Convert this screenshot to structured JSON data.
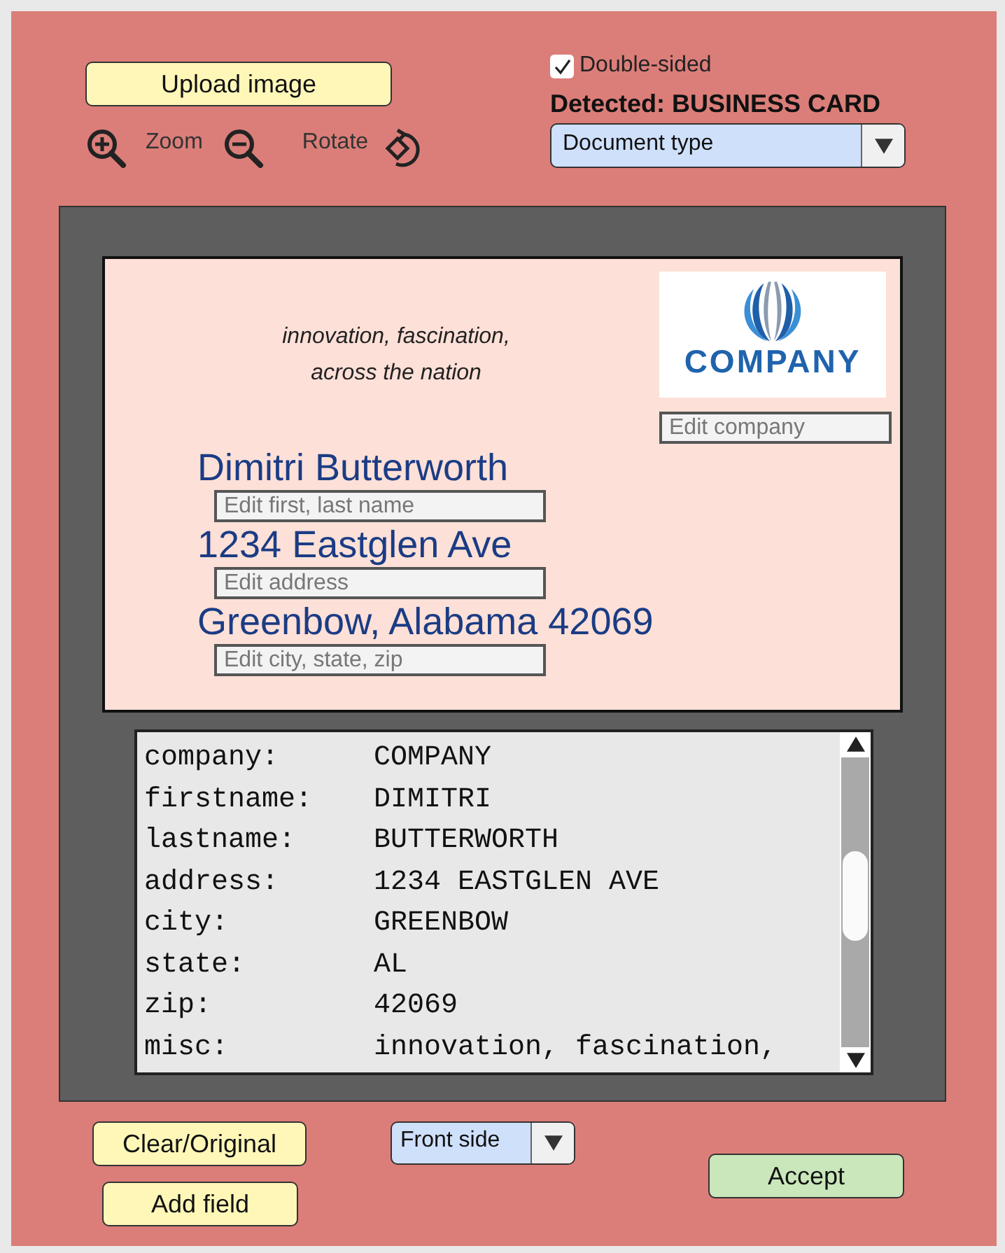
{
  "toolbar": {
    "upload_button": "Upload image",
    "zoom_label": "Zoom",
    "rotate_label": "Rotate"
  },
  "double_sided": {
    "label": "Double-sided",
    "checked": true
  },
  "detected": "Detected: BUSINESS CARD",
  "document_type": {
    "value": "Document type"
  },
  "card": {
    "tagline": [
      "innovation, fascination,",
      "across the nation"
    ],
    "logo_text": "COMPANY",
    "company_field": {
      "placeholder": "Edit company"
    },
    "lines": [
      {
        "text": "Dimitri Butterworth",
        "placeholder": "Edit first, last name"
      },
      {
        "text": "1234 Eastglen Ave",
        "placeholder": "Edit address"
      },
      {
        "text": "Greenbow, Alabama 42069",
        "placeholder": "Edit city, state, zip"
      }
    ]
  },
  "fields": [
    {
      "key": "company:",
      "value": "COMPANY"
    },
    {
      "key": "firstname:",
      "value": "DIMITRI"
    },
    {
      "key": "lastname:",
      "value": "BUTTERWORTH"
    },
    {
      "key": "address:",
      "value": "1234 EASTGLEN AVE"
    },
    {
      "key": "city:",
      "value": "GREENBOW"
    },
    {
      "key": "state:",
      "value": "AL"
    },
    {
      "key": "zip:",
      "value": "42069"
    },
    {
      "key": "misc:",
      "value": "innovation, fascination,"
    }
  ],
  "bottom": {
    "clear_button": "Clear/Original",
    "add_field_button": "Add field",
    "side": {
      "value": "Front side"
    },
    "accept_button": "Accept"
  }
}
